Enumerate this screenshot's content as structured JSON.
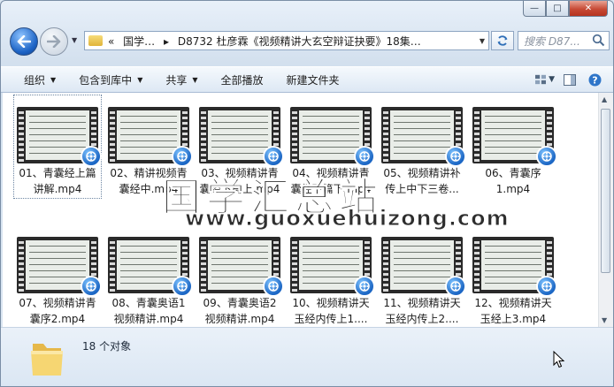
{
  "window": {
    "controls": {
      "minimize": "—",
      "maximize": "□",
      "close": "✕"
    }
  },
  "nav": {
    "breadcrumb": [
      "«",
      "国学…",
      "▸",
      "D8732 杜彦霖《视频精讲大玄空辩证抉要》18集…"
    ],
    "search_placeholder": "搜索 D87..."
  },
  "toolbar": {
    "items": [
      "组织",
      "包含到库中",
      "共享",
      "全部播放",
      "新建文件夹"
    ]
  },
  "files": [
    {
      "line1": "01、青囊经上篇",
      "line2": "讲解.mp4"
    },
    {
      "line1": "02、精讲视频青",
      "line2": "囊经中.mp4"
    },
    {
      "line1": "03、视频精讲青",
      "line2": "囊经下篇上.mp4"
    },
    {
      "line1": "04、视频精讲青",
      "line2": "囊经下篇下.mp4"
    },
    {
      "line1": "05、视频精讲补",
      "line2": "传上中下三卷..."
    },
    {
      "line1": "06、青囊序",
      "line2": "1.mp4"
    },
    {
      "line1": "07、视频精讲青",
      "line2": "囊序2.mp4"
    },
    {
      "line1": "08、青囊奥语1",
      "line2": "视频精讲.mp4"
    },
    {
      "line1": "09、青囊奥语2",
      "line2": "视频精讲.mp4"
    },
    {
      "line1": "10、视频精讲天",
      "line2": "玉经内传上1...."
    },
    {
      "line1": "11、视频精讲天",
      "line2": "玉经内传上2...."
    },
    {
      "line1": "12、视频精讲天",
      "line2": "玉经上3.mp4"
    }
  ],
  "watermark": {
    "cn": "国学汇总站",
    "url": "www.guoxuehuizong.com"
  },
  "status": {
    "count": "18 个对象"
  }
}
